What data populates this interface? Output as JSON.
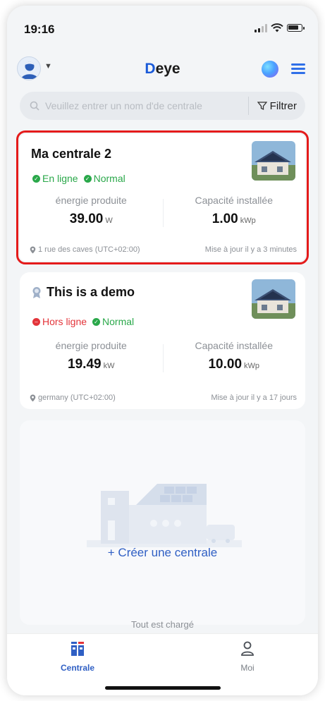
{
  "status_bar": {
    "time": "19:16"
  },
  "header": {
    "logo_initial": "D",
    "logo_rest": "eye"
  },
  "search": {
    "placeholder": "Veuillez entrer un nom d'de centrale",
    "filter_label": "Filtrer"
  },
  "plants": [
    {
      "name": "Ma centrale 2",
      "connection_status": "En ligne",
      "connection_color": "#2aa84a",
      "health_status": "Normal",
      "health_color": "#2aa84a",
      "energy_label": "énergie produite",
      "energy_value": "39.00",
      "energy_unit": "W",
      "capacity_label": "Capacité installée",
      "capacity_value": "1.00",
      "capacity_unit": "kWp",
      "location": "1 rue des caves (UTC+02:00)",
      "updated": "Mise à jour il y a  3 minutes"
    },
    {
      "name": "This is a demo",
      "connection_status": "Hors ligne",
      "connection_color": "#e3343a",
      "health_status": "Normal",
      "health_color": "#2aa84a",
      "energy_label": "énergie produite",
      "energy_value": "19.49",
      "energy_unit": "kW",
      "capacity_label": "Capacité installée",
      "capacity_value": "10.00",
      "capacity_unit": "kWp",
      "location": "germany (UTC+02:00)",
      "updated": "Mise à jour il y a  17 jours"
    }
  ],
  "create": {
    "label": "+ Créer une centrale"
  },
  "footer_text": "Tout est chargé",
  "tabs": [
    {
      "label": "Centrale",
      "active": true,
      "color": "#2f5fc4"
    },
    {
      "label": "Moi",
      "active": false,
      "color": "#7a7f86"
    }
  ],
  "icons": {
    "avatar": "user-avatar-icon",
    "globe": "globe-icon",
    "menu": "list-menu-icon",
    "search": "search-icon",
    "filter": "filter-icon",
    "location": "location-pin-icon",
    "demo": "demo-badge-icon",
    "tab_plant": "plant-tab-icon",
    "tab_me": "person-icon"
  }
}
